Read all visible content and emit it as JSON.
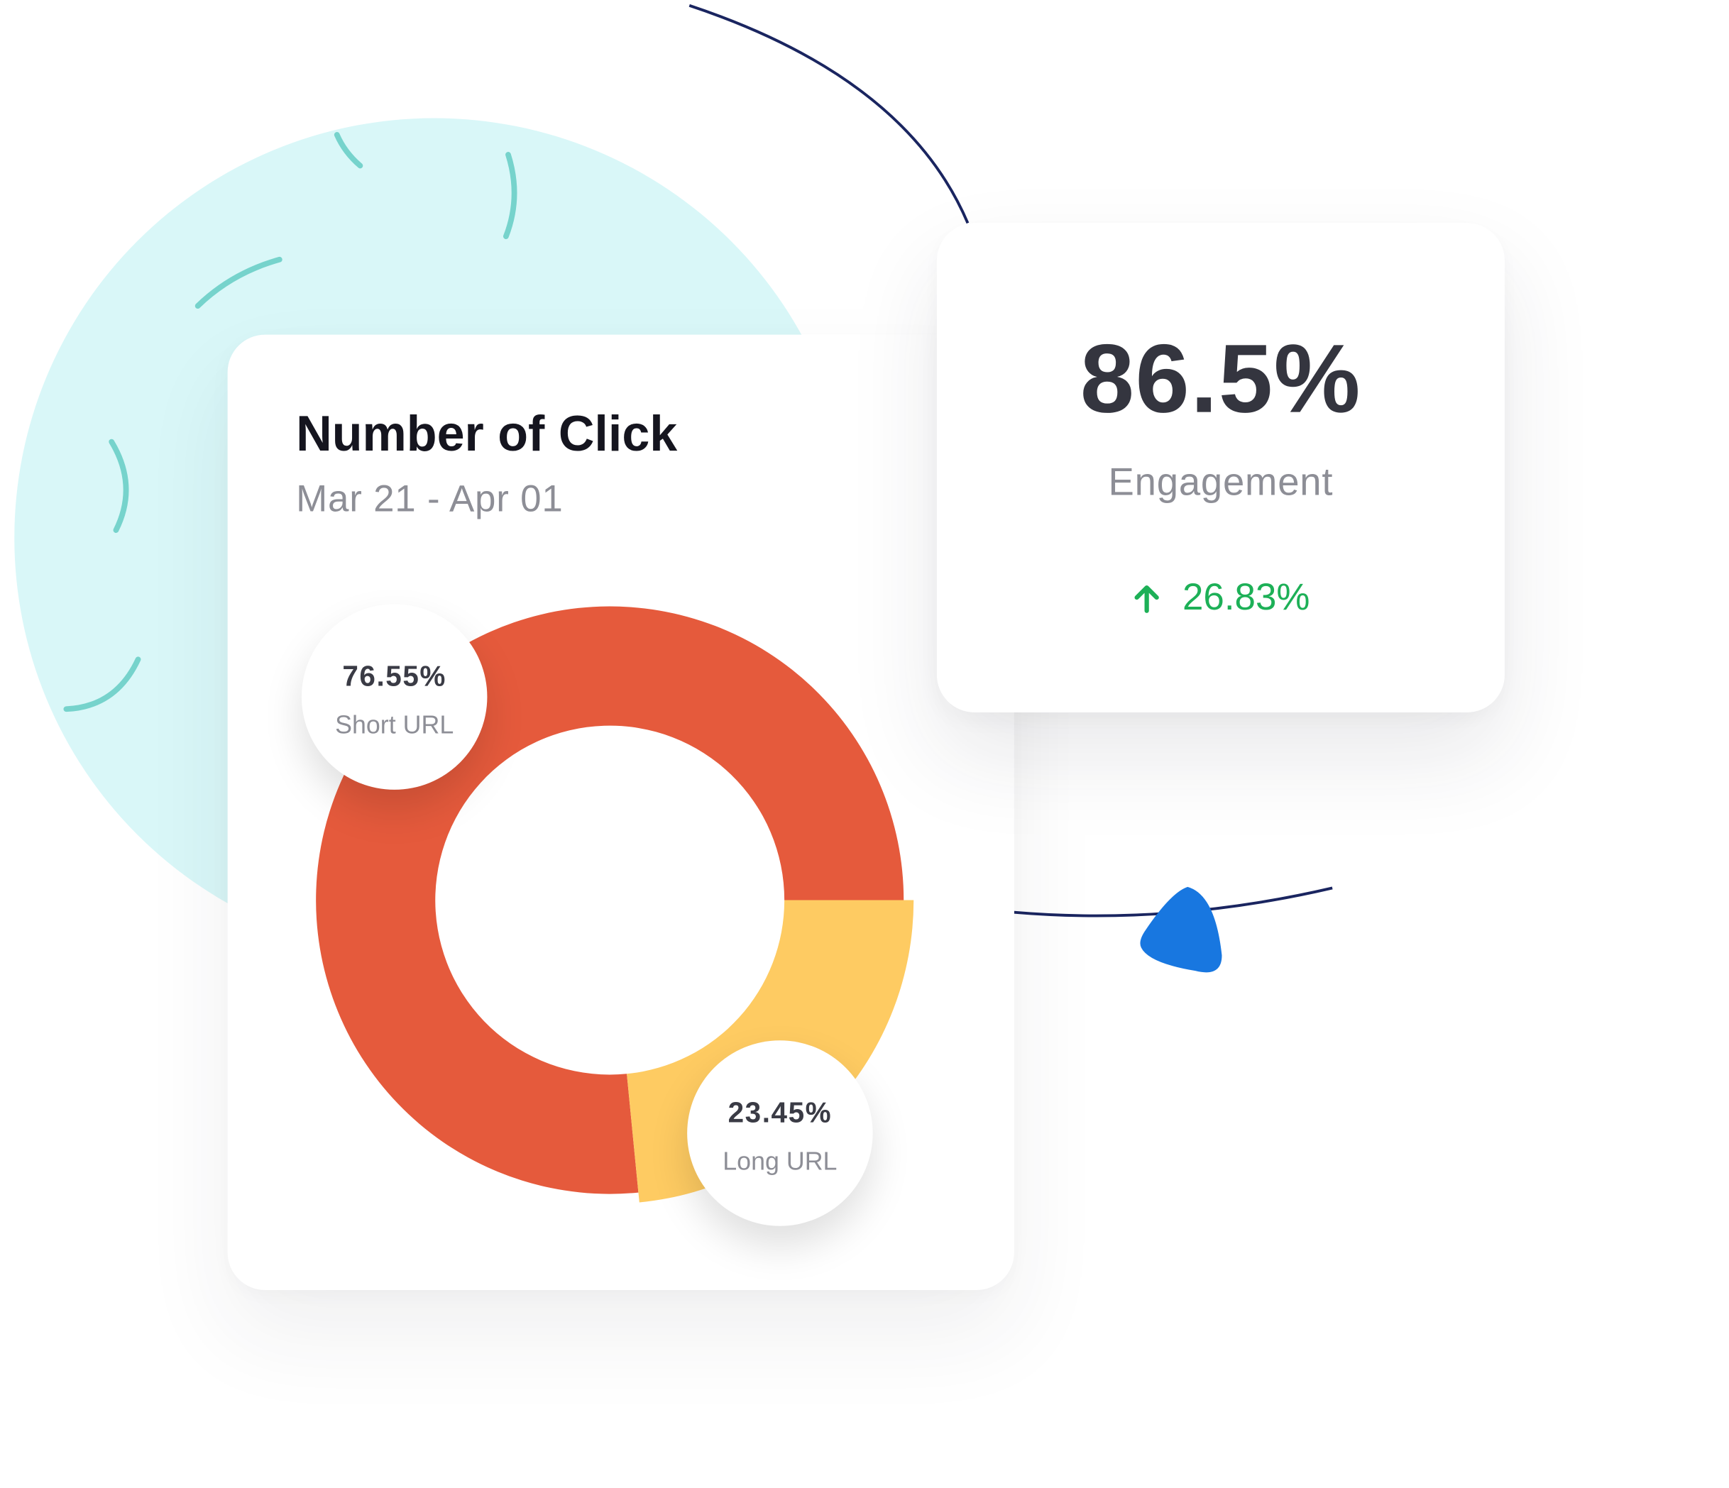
{
  "colors": {
    "short_url": "#e55a3c",
    "long_url": "#fecb62",
    "positive_change": "#1db057",
    "decor_circle": "#d9f7f8",
    "decor_accent": "#1877e0"
  },
  "clicks_card": {
    "title": "Number of Click",
    "date_range": "Mar 21 - Apr 01"
  },
  "engagement_card": {
    "value": "86.5%",
    "label": "Engagement",
    "change": "26.83%",
    "change_icon": "arrow-up-icon"
  },
  "chart_data": {
    "type": "pie",
    "title": "Number of Click",
    "subtitle": "Mar 21 - Apr 01",
    "categories": [
      "Short URL",
      "Long URL"
    ],
    "values": [
      76.55,
      23.45
    ],
    "labels": [
      {
        "value": "76.55%",
        "name": "Short URL"
      },
      {
        "value": "23.45%",
        "name": "Long URL"
      }
    ],
    "donut": true
  }
}
